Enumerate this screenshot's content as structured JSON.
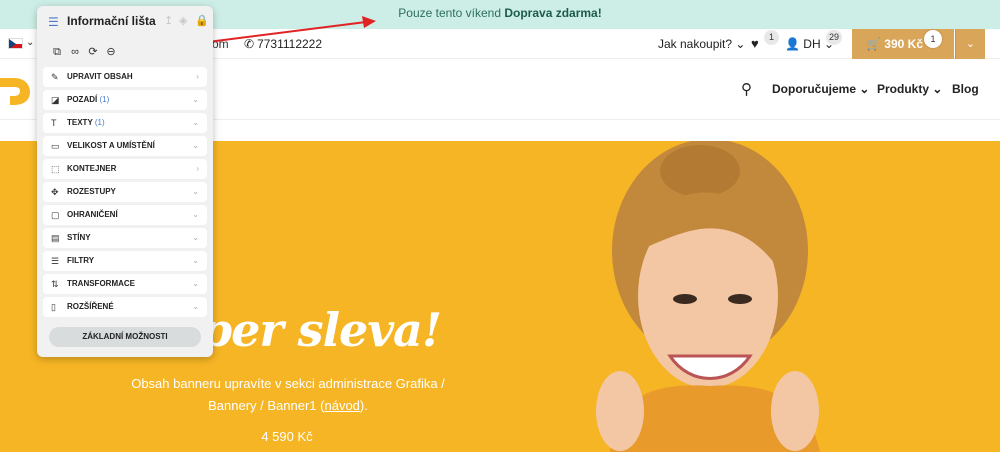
{
  "topbar": {
    "text_prefix": "Pouze tento víkend ",
    "text_bold": "Doprava zdarma!"
  },
  "header": {
    "language_chevron": "⌄",
    "partial_text": "om",
    "phone": "7731112222",
    "how_to_buy": "Jak nakoupit? ⌄",
    "wishlist_count": "1",
    "user_initials": "DH ⌄",
    "user_count": "29",
    "cart_total": "390 Kč",
    "cart_count": "1"
  },
  "nav": {
    "items": [
      {
        "label": "Doporučujeme ⌄"
      },
      {
        "label": "Produkty ⌄"
      },
      {
        "label": "Blog"
      }
    ]
  },
  "banner": {
    "headline": "per sleva!",
    "description_line1": "Obsah banneru upravíte v sekci administrace Grafika /",
    "description_line2_before": "Bannery / Banner1 (",
    "description_link": "návod",
    "description_line2_after": ").",
    "price": "4 590 Kč",
    "background_color": "#f6b525"
  },
  "editor_panel": {
    "title": "Informační lišta",
    "sections": [
      {
        "label": "UPRAVIT OBSAH",
        "count": "",
        "icon": "pencil-icon",
        "chevron": "›"
      },
      {
        "label": "POZADÍ",
        "count": "(1)",
        "icon": "paint-bucket-icon",
        "chevron": "⌄"
      },
      {
        "label": "TEXTY",
        "count": "(1)",
        "icon": "text-icon",
        "chevron": "⌄"
      },
      {
        "label": "VELIKOST A UMÍSTĚNÍ",
        "count": "",
        "icon": "size-icon",
        "chevron": "⌄"
      },
      {
        "label": "KONTEJNER",
        "count": "",
        "icon": "container-icon",
        "chevron": "›"
      },
      {
        "label": "ROZESTUPY",
        "count": "",
        "icon": "spacing-icon",
        "chevron": "⌄"
      },
      {
        "label": "OHRANIČENÍ",
        "count": "",
        "icon": "border-icon",
        "chevron": "⌄"
      },
      {
        "label": "STÍNY",
        "count": "",
        "icon": "shadow-icon",
        "chevron": "⌄"
      },
      {
        "label": "FILTRY",
        "count": "",
        "icon": "filter-icon",
        "chevron": "⌄"
      },
      {
        "label": "TRANSFORMACE",
        "count": "",
        "icon": "transform-icon",
        "chevron": "⌄"
      },
      {
        "label": "ROZŠÍŘENÉ",
        "count": "",
        "icon": "advanced-icon",
        "chevron": "⌄"
      }
    ],
    "basic_options_button": "ZÁKLADNÍ MOŽNOSTI"
  },
  "colors": {
    "accent": "#d9a558",
    "topbar_bg": "#cdeee6",
    "annotation_arrow": "#e02424"
  }
}
